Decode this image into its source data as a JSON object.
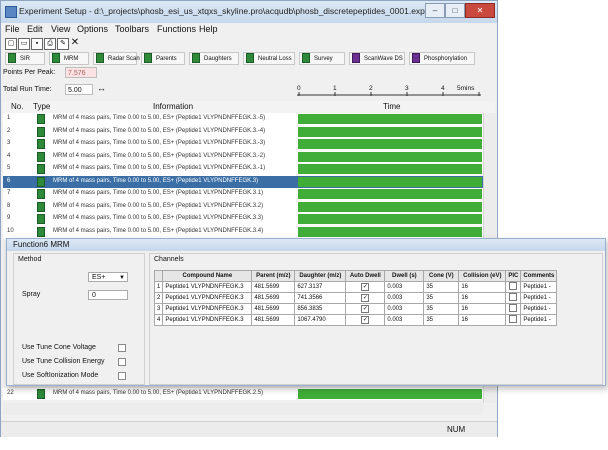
{
  "window": {
    "title": "Experiment Setup - d:\\_projects\\phosb_esi_us_xtqxs_skyline.pro\\acqudb\\phosb_discretepeptides_0001.exp",
    "controls": [
      "–",
      "□",
      "✕"
    ]
  },
  "menu": [
    "File",
    "Edit",
    "View",
    "Options",
    "Toolbars",
    "Functions",
    "Help"
  ],
  "toolbar_icons": [
    "new-icon",
    "open-icon",
    "save-icon",
    "print-icon",
    "edit-icon",
    "delete-icon"
  ],
  "function_buttons": [
    "SIR",
    "MRM",
    "Radar Scan",
    "Parents",
    "Daughters",
    "Neutral Loss",
    "Survey",
    "ScanWave DS",
    "Phosphorylation"
  ],
  "points_per_peak": {
    "label": "Points Per Peak:",
    "value": "7.576"
  },
  "total_run_time": {
    "label": "Total Run Time:",
    "value": "5.00"
  },
  "time_axis": {
    "ticks": [
      "0",
      "1",
      "2",
      "3",
      "4",
      "5mins"
    ]
  },
  "columns": {
    "no": "No.",
    "type": "Type",
    "info": "Information",
    "time": "Time"
  },
  "rows": [
    {
      "no": "1",
      "info": "MRM of 4 mass pairs, Time 0.00 to 5.00, ES+ (Peptide1 VLYPNDNFFEGK.3.-5)"
    },
    {
      "no": "2",
      "info": "MRM of 4 mass pairs, Time 0.00 to 5.00, ES+ (Peptide1 VLYPNDNFFEGK.3.-4)"
    },
    {
      "no": "3",
      "info": "MRM of 4 mass pairs, Time 0.00 to 5.00, ES+ (Peptide1 VLYPNDNFFEGK.3.-3)"
    },
    {
      "no": "4",
      "info": "MRM of 4 mass pairs, Time 0.00 to 5.00, ES+ (Peptide1 VLYPNDNFFEGK.3.-2)"
    },
    {
      "no": "5",
      "info": "MRM of 4 mass pairs, Time 0.00 to 5.00, ES+ (Peptide1 VLYPNDNFFEGK.3.-1)"
    },
    {
      "no": "6",
      "info": "MRM of 4 mass pairs, Time 0.00 to 5.00, ES+ (Peptide1 VLYPNDNFFEGK.3)",
      "selected": true
    },
    {
      "no": "7",
      "info": "MRM of 4 mass pairs, Time 0.00 to 5.00, ES+ (Peptide1 VLYPNDNFFEGK.3.1)"
    },
    {
      "no": "8",
      "info": "MRM of 4 mass pairs, Time 0.00 to 5.00, ES+ (Peptide1 VLYPNDNFFEGK.3.2)"
    },
    {
      "no": "9",
      "info": "MRM of 4 mass pairs, Time 0.00 to 5.00, ES+ (Peptide1 VLYPNDNFFEGK.3.3)"
    },
    {
      "no": "10",
      "info": "MRM of 4 mass pairs, Time 0.00 to 5.00, ES+ (Peptide1 VLYPNDNFFEGK.3.4)"
    }
  ],
  "bottom_row": {
    "no": "22",
    "info": "MRM of 4 mass pairs, Time 0.00 to 5.00, ES+ (Peptide1 VLYPNDNFFEGK.2.5)"
  },
  "status": {
    "num": "NUM"
  },
  "dialog": {
    "title": "Function6 MRM",
    "method_label": "Method",
    "polarity": "ES+",
    "spray_label": "Spray",
    "spray_value": "0",
    "opt_tune_cone": "Use Tune Cone Voltage",
    "opt_tune_collision": "Use Tune Collision Energy",
    "opt_softionization": "Use SoftIonization Mode",
    "channels_label": "Channels",
    "headers": [
      "Compound Name",
      "Parent (m/z)",
      "Daughter (m/z)",
      "Auto Dwell",
      "Dwell (s)",
      "Cone (V)",
      "Collision (eV)",
      "PIC",
      "Comments"
    ],
    "channels": [
      {
        "idx": "1",
        "name": "Peptide1 VLYPNDNFFEGK.3",
        "parent": "481.5699",
        "daughter": "627.3137",
        "auto": "✓",
        "dwell": "0.003",
        "cone": "35",
        "collision": "16",
        "comment": "Peptide1 -"
      },
      {
        "idx": "2",
        "name": "Peptide1 VLYPNDNFFEGK.3",
        "parent": "481.5699",
        "daughter": "741.3566",
        "auto": "✓",
        "dwell": "0.003",
        "cone": "35",
        "collision": "16",
        "comment": "Peptide1 -"
      },
      {
        "idx": "3",
        "name": "Peptide1 VLYPNDNFFEGK.3",
        "parent": "481.5699",
        "daughter": "856.3835",
        "auto": "✓",
        "dwell": "0.003",
        "cone": "35",
        "collision": "16",
        "comment": "Peptide1 -"
      },
      {
        "idx": "4",
        "name": "Peptide1 VLYPNDNFFEGK.3",
        "parent": "481.5699",
        "daughter": "1067.4790",
        "auto": "✓",
        "dwell": "0.003",
        "cone": "35",
        "collision": "16",
        "comment": "Peptide1 -"
      }
    ]
  }
}
